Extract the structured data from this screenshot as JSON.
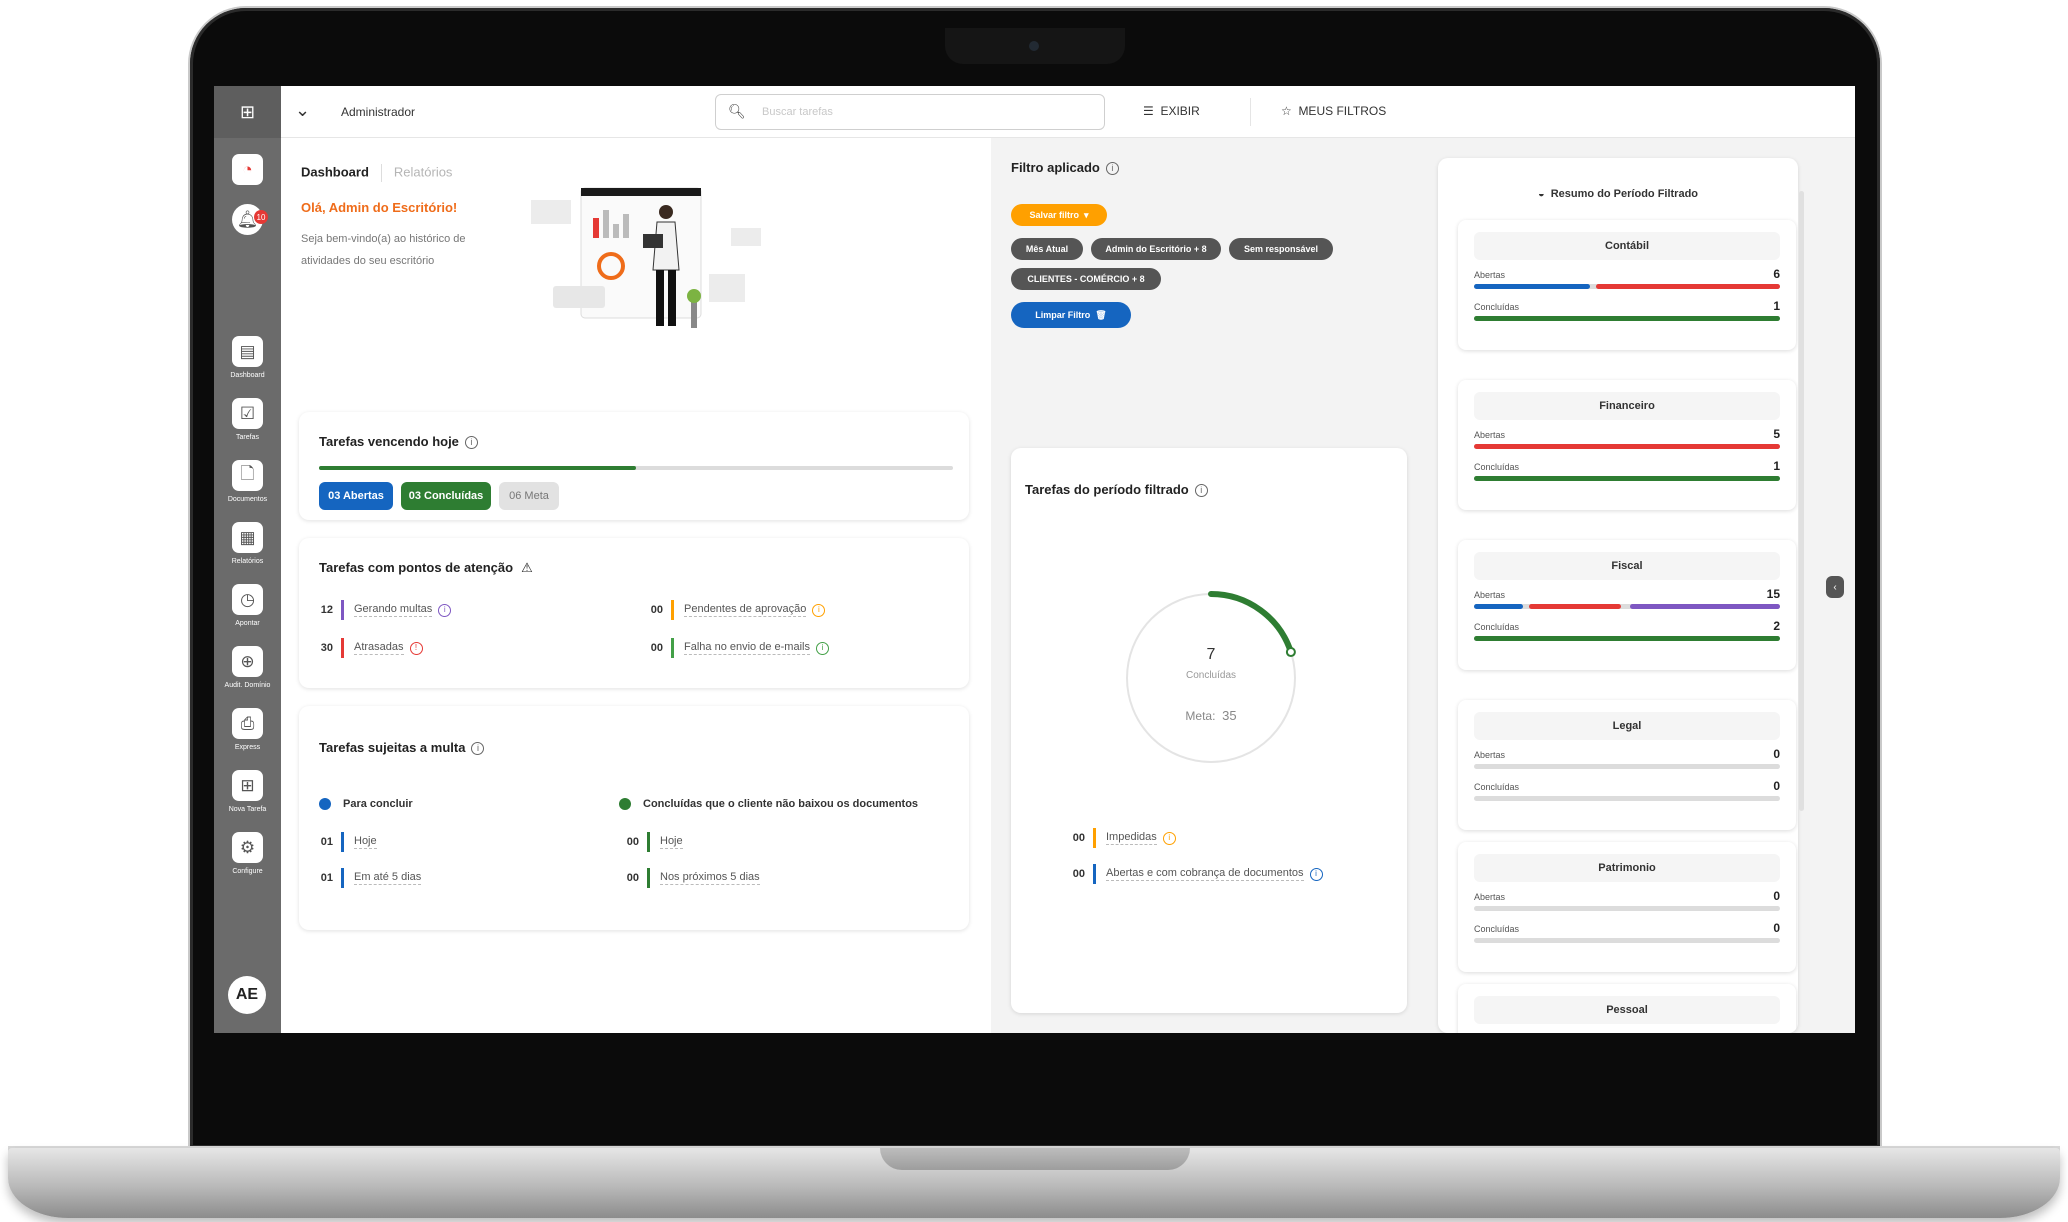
{
  "topbar": {
    "user": "Administrador",
    "search_placeholder": "Buscar tarefas",
    "exibir": "EXIBIR",
    "meus_filtros": "MEUS FILTROS"
  },
  "sidebar": {
    "notification_count": "10",
    "items": [
      {
        "label": "Dashboard",
        "icon": "layout-icon"
      },
      {
        "label": "Tarefas",
        "icon": "checkbox-icon"
      },
      {
        "label": "Documentos",
        "icon": "document-icon"
      },
      {
        "label": "Relatórios",
        "icon": "report-icon"
      },
      {
        "label": "Apontar",
        "icon": "clock-icon"
      },
      {
        "label": "Audit. Domínio",
        "icon": "audit-icon"
      },
      {
        "label": "Express",
        "icon": "express-icon"
      },
      {
        "label": "Nova Tarefa",
        "icon": "plus-icon"
      },
      {
        "label": "Configure",
        "icon": "gear-icon"
      }
    ],
    "avatar": "AE"
  },
  "dashboard": {
    "tab_active": "Dashboard",
    "tab_inactive": "Relatórios",
    "greeting": "Olá, Admin do Escritório!",
    "welcome": "Seja bem-vindo(a) ao histórico de atividades do seu escritório"
  },
  "vencendo": {
    "title": "Tarefas vencendo hoje",
    "progress": 0.5,
    "abertas": "03  Abertas",
    "concluidas": "03  Concluídas",
    "meta": "06  Meta"
  },
  "atencao": {
    "title": "Tarefas com pontos de atenção",
    "items": [
      {
        "num": "12",
        "label": "Gerando multas",
        "color": "#7e57c2"
      },
      {
        "num": "30",
        "label": "Atrasadas",
        "color": "#e53935"
      },
      {
        "num": "00",
        "label": "Pendentes de aprovação",
        "color": "#ffa000"
      },
      {
        "num": "00",
        "label": "Falha no envio de e-mails",
        "color": "#43a047"
      }
    ]
  },
  "multa": {
    "title": "Tarefas sujeitas a multa",
    "col1_title": "Para concluir",
    "col2_title": "Concluídas que o cliente não baixou os documentos",
    "col1": [
      {
        "num": "01",
        "label": "Hoje"
      },
      {
        "num": "01",
        "label": "Em até 5 dias"
      }
    ],
    "col2": [
      {
        "num": "00",
        "label": "Hoje"
      },
      {
        "num": "00",
        "label": "Nos próximos 5 dias"
      }
    ]
  },
  "filtro": {
    "title": "Filtro aplicado",
    "salvar": "Salvar filtro",
    "chips": [
      "Mês Atual",
      "Admin do Escritório + 8",
      "Sem responsável",
      "CLIENTES - COMÉRCIO + 8"
    ],
    "limpar": "Limpar Filtro"
  },
  "periodo": {
    "title": "Tarefas do período filtrado",
    "concluidas_value": "7",
    "concluidas_label": "Concluídas",
    "meta_label": "Meta:",
    "meta_value": "35",
    "ratio": 0.2,
    "items": [
      {
        "num": "00",
        "label": "Impedidas",
        "color": "#ffa000"
      },
      {
        "num": "00",
        "label": "Abertas e com cobrança de documentos",
        "color": "#1565c0"
      }
    ]
  },
  "resumo": {
    "title": "Resumo do Período Filtrado",
    "label_abertas": "Abertas",
    "label_concluidas": "Concluídas",
    "cards": [
      {
        "name": "Contábil",
        "abertas": "6",
        "concluidas": "1"
      },
      {
        "name": "Financeiro",
        "abertas": "5",
        "concluidas": "1"
      },
      {
        "name": "Fiscal",
        "abertas": "15",
        "concluidas": "2"
      },
      {
        "name": "Legal",
        "abertas": "0",
        "concluidas": "0"
      },
      {
        "name": "Patrimonio",
        "abertas": "0",
        "concluidas": "0"
      },
      {
        "name": "Pessoal",
        "abertas": "",
        "concluidas": ""
      }
    ]
  },
  "colors": {
    "blue": "#1565c0",
    "green": "#2e7d32",
    "red": "#e53935",
    "purple": "#7e57c2",
    "orange": "#ffa000",
    "greeting": "#ef6c1a"
  }
}
